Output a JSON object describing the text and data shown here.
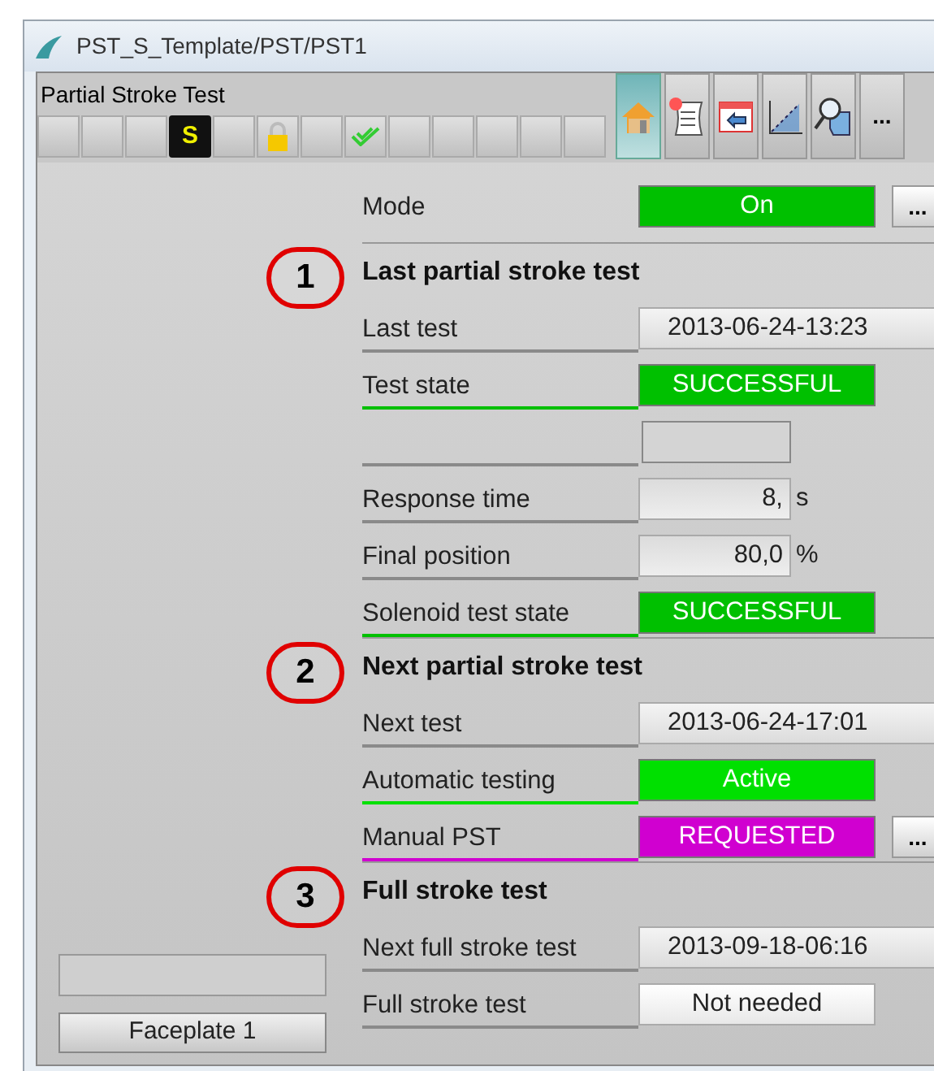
{
  "window": {
    "title": "PST_S_Template/PST/PST1"
  },
  "header": {
    "title": "Partial Stroke Test",
    "status_buttons": [
      {
        "kind": "blank"
      },
      {
        "kind": "blank"
      },
      {
        "kind": "blank"
      },
      {
        "kind": "letter",
        "label": "S"
      },
      {
        "kind": "blank"
      },
      {
        "kind": "lock"
      },
      {
        "kind": "blank"
      },
      {
        "kind": "check"
      },
      {
        "kind": "blank"
      },
      {
        "kind": "blank"
      },
      {
        "kind": "blank"
      },
      {
        "kind": "blank"
      },
      {
        "kind": "blank"
      }
    ],
    "toolbar": [
      {
        "kind": "home",
        "selected": true
      },
      {
        "kind": "document",
        "selected": false
      },
      {
        "kind": "window",
        "selected": false
      },
      {
        "kind": "chart",
        "selected": false
      },
      {
        "kind": "search",
        "selected": false
      },
      {
        "kind": "more",
        "label": "...",
        "selected": false
      }
    ]
  },
  "rows": [
    {
      "kind": "status",
      "label": "Mode",
      "value": "On",
      "color": "#00c000",
      "more": "..."
    },
    {
      "kind": "heading",
      "label": "Last partial stroke test",
      "marker": "1"
    },
    {
      "kind": "date",
      "label": "Last test",
      "value": "2013-06-24-13:23"
    },
    {
      "kind": "status",
      "label": "Test state",
      "value": "SUCCESSFUL",
      "color": "#00c000"
    },
    {
      "kind": "blank"
    },
    {
      "kind": "number",
      "label": "Response time",
      "value": "8,",
      "unit": "s"
    },
    {
      "kind": "number",
      "label": "Final position",
      "value": "80,0",
      "unit": "%"
    },
    {
      "kind": "status",
      "label": "Solenoid test state",
      "value": "SUCCESSFUL",
      "color": "#00c000"
    },
    {
      "kind": "heading",
      "label": "Next partial stroke test",
      "marker": "2"
    },
    {
      "kind": "date",
      "label": "Next test",
      "value": "2013-06-24-17:01"
    },
    {
      "kind": "status",
      "label": "Automatic testing",
      "value": "Active",
      "color": "#00e000"
    },
    {
      "kind": "status",
      "label": "Manual PST",
      "value": "REQUESTED",
      "color": "#d000d0",
      "more": "..."
    },
    {
      "kind": "heading",
      "label": "Full stroke test",
      "marker": "3"
    },
    {
      "kind": "date",
      "label": "Next full stroke test",
      "value": "2013-09-18-06:16"
    },
    {
      "kind": "text",
      "label": "Full stroke test",
      "value": "Not needed"
    }
  ],
  "left_panel": {
    "button": "Faceplate 1"
  }
}
